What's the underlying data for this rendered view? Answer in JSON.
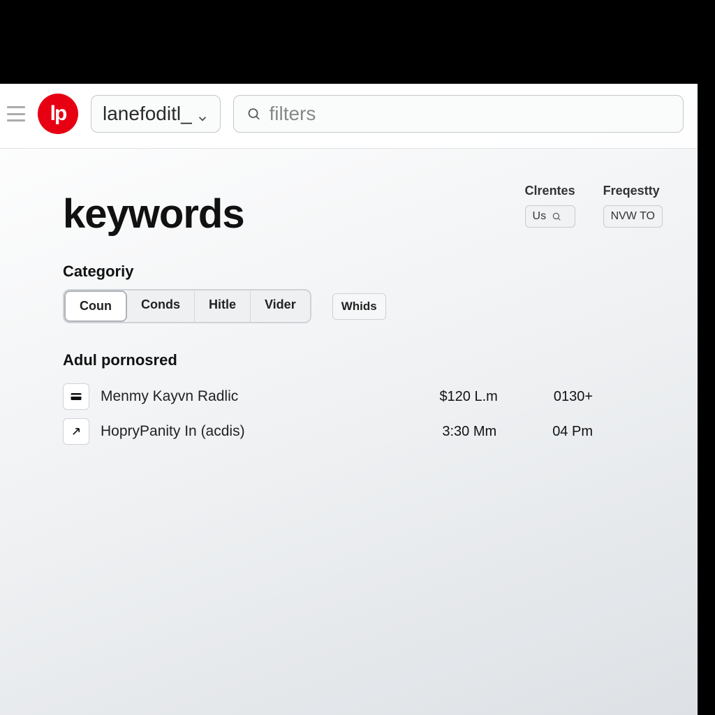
{
  "brand": {
    "logo_text": "lp"
  },
  "topbar": {
    "dropdown_value": "lanefoditl_",
    "search_placeholder": "filters"
  },
  "page": {
    "title": "keywords"
  },
  "columns": {
    "clients": {
      "label": "Clrentes",
      "pill_value": "Us"
    },
    "frequency": {
      "label": "Freqestty",
      "pill_value": "NVW TO"
    }
  },
  "category": {
    "label": "Categoriy",
    "tabs": [
      "Coun",
      "Conds",
      "Hitle",
      "Vider"
    ],
    "active_index": 0,
    "secondary": [
      "Whids"
    ]
  },
  "results": {
    "group_title": "Adul pornosred",
    "rows": [
      {
        "label": "Menmy Kayvn Radlic",
        "v1": "$120 L.m",
        "v2": "0130+"
      },
      {
        "label": "HopryPanity In (acdis)",
        "v1": "3:30 Mm",
        "v2": "04 Pm"
      }
    ]
  }
}
